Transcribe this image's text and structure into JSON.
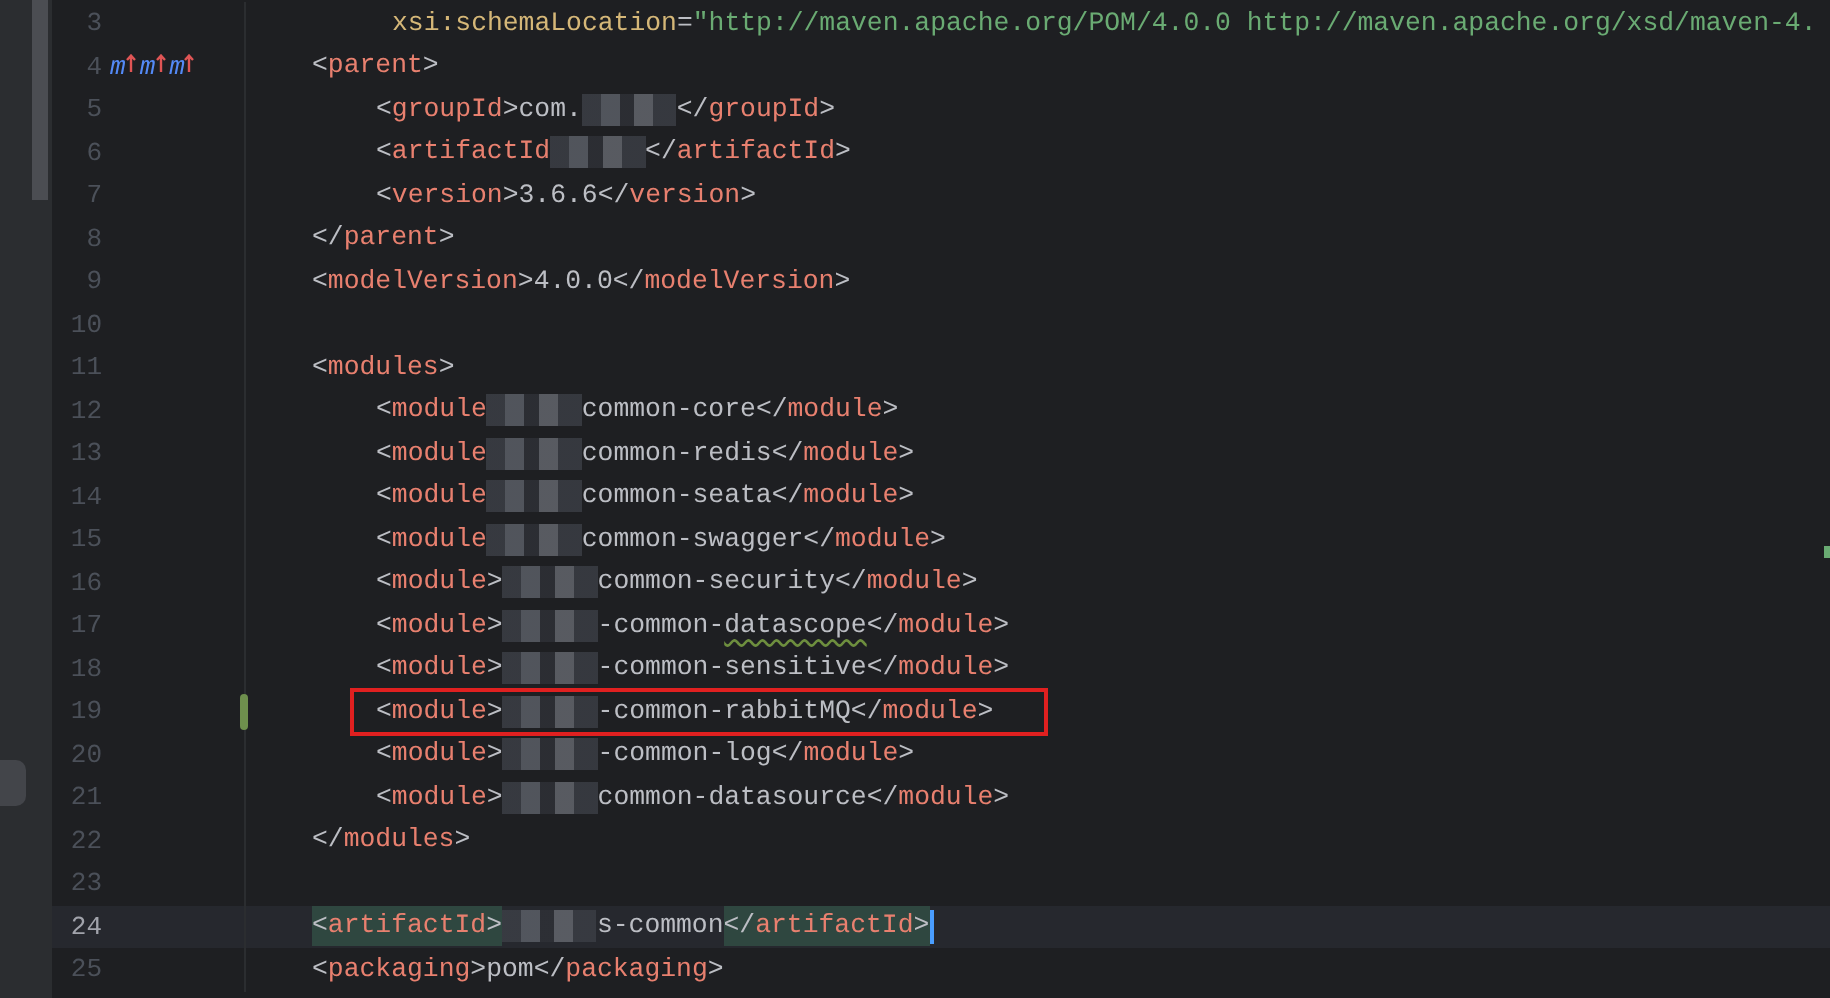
{
  "editor": {
    "lines": [
      {
        "number": "3",
        "continuation": true,
        "segments": [
          {
            "kind": "code",
            "tokens": [
              {
                "kind": "attr",
                "text": "xsi:schemaLocation"
              },
              {
                "kind": "punct",
                "text": "="
              },
              {
                "kind": "value",
                "text": "\"http://maven.apache.org/POM/4.0.0 http://maven.apache.org/xsd/maven-4."
              }
            ]
          }
        ]
      },
      {
        "number": "4",
        "gutter_marks": [
          "m",
          "m",
          "m"
        ],
        "segments": [
          {
            "kind": "code",
            "tokens": [
              {
                "kind": "punct",
                "text": "<"
              },
              {
                "kind": "tag",
                "text": "parent"
              },
              {
                "kind": "punct",
                "text": ">"
              }
            ]
          }
        ]
      },
      {
        "number": "5",
        "indented": true,
        "segments": [
          {
            "kind": "code",
            "tokens": [
              {
                "kind": "punct",
                "text": "<"
              },
              {
                "kind": "tag",
                "text": "groupId"
              },
              {
                "kind": "punct",
                "text": ">"
              },
              {
                "kind": "plain",
                "text": "com."
              }
            ]
          },
          {
            "kind": "redacted"
          },
          {
            "kind": "code",
            "tokens": [
              {
                "kind": "punct",
                "text": "</"
              },
              {
                "kind": "tag",
                "text": "groupId"
              },
              {
                "kind": "punct",
                "text": ">"
              }
            ]
          }
        ]
      },
      {
        "number": "6",
        "indented": true,
        "segments": [
          {
            "kind": "code",
            "tokens": [
              {
                "kind": "punct",
                "text": "<"
              },
              {
                "kind": "tag",
                "text": "artifactId"
              }
            ]
          },
          {
            "kind": "redacted"
          },
          {
            "kind": "code",
            "tokens": [
              {
                "kind": "punct",
                "text": "</"
              },
              {
                "kind": "tag",
                "text": "artifactId"
              },
              {
                "kind": "punct",
                "text": ">"
              }
            ]
          }
        ]
      },
      {
        "number": "7",
        "indented": true,
        "segments": [
          {
            "kind": "code",
            "tokens": [
              {
                "kind": "punct",
                "text": "<"
              },
              {
                "kind": "tag",
                "text": "version"
              },
              {
                "kind": "punct",
                "text": ">"
              },
              {
                "kind": "plain",
                "text": "3.6.6"
              },
              {
                "kind": "punct",
                "text": "</"
              },
              {
                "kind": "tag",
                "text": "version"
              },
              {
                "kind": "punct",
                "text": ">"
              }
            ]
          }
        ]
      },
      {
        "number": "8",
        "segments": [
          {
            "kind": "code",
            "tokens": [
              {
                "kind": "punct",
                "text": "</"
              },
              {
                "kind": "tag",
                "text": "parent"
              },
              {
                "kind": "punct",
                "text": ">"
              }
            ]
          }
        ]
      },
      {
        "number": "9",
        "segments": [
          {
            "kind": "code",
            "tokens": [
              {
                "kind": "punct",
                "text": "<"
              },
              {
                "kind": "tag",
                "text": "modelVersion"
              },
              {
                "kind": "punct",
                "text": ">"
              },
              {
                "kind": "plain",
                "text": "4.0.0"
              },
              {
                "kind": "punct",
                "text": "</"
              },
              {
                "kind": "tag",
                "text": "modelVersion"
              },
              {
                "kind": "punct",
                "text": ">"
              }
            ]
          }
        ]
      },
      {
        "number": "10"
      },
      {
        "number": "11",
        "segments": [
          {
            "kind": "code",
            "tokens": [
              {
                "kind": "punct",
                "text": "<"
              },
              {
                "kind": "tag",
                "text": "modules"
              },
              {
                "kind": "punct",
                "text": ">"
              }
            ]
          }
        ]
      },
      {
        "number": "12",
        "indented": true,
        "segments": [
          {
            "kind": "code",
            "tokens": [
              {
                "kind": "punct",
                "text": "<"
              },
              {
                "kind": "tag",
                "text": "module"
              }
            ]
          },
          {
            "kind": "redacted"
          },
          {
            "kind": "code",
            "tokens": [
              {
                "kind": "plain",
                "text": "common-core"
              },
              {
                "kind": "punct",
                "text": "</"
              },
              {
                "kind": "tag",
                "text": "module"
              },
              {
                "kind": "punct",
                "text": ">"
              }
            ]
          }
        ]
      },
      {
        "number": "13",
        "indented": true,
        "segments": [
          {
            "kind": "code",
            "tokens": [
              {
                "kind": "punct",
                "text": "<"
              },
              {
                "kind": "tag",
                "text": "module"
              }
            ]
          },
          {
            "kind": "redacted"
          },
          {
            "kind": "code",
            "tokens": [
              {
                "kind": "plain",
                "text": "common-redis"
              },
              {
                "kind": "punct",
                "text": "</"
              },
              {
                "kind": "tag",
                "text": "module"
              },
              {
                "kind": "punct",
                "text": ">"
              }
            ]
          }
        ]
      },
      {
        "number": "14",
        "indented": true,
        "segments": [
          {
            "kind": "code",
            "tokens": [
              {
                "kind": "punct",
                "text": "<"
              },
              {
                "kind": "tag",
                "text": "module"
              }
            ]
          },
          {
            "kind": "redacted"
          },
          {
            "kind": "code",
            "tokens": [
              {
                "kind": "plain",
                "text": "common-seata"
              },
              {
                "kind": "punct",
                "text": "</"
              },
              {
                "kind": "tag",
                "text": "module"
              },
              {
                "kind": "punct",
                "text": ">"
              }
            ]
          }
        ]
      },
      {
        "number": "15",
        "indented": true,
        "segments": [
          {
            "kind": "code",
            "tokens": [
              {
                "kind": "punct",
                "text": "<"
              },
              {
                "kind": "tag",
                "text": "module"
              }
            ]
          },
          {
            "kind": "redacted"
          },
          {
            "kind": "code",
            "tokens": [
              {
                "kind": "plain",
                "text": "common-swagger"
              },
              {
                "kind": "punct",
                "text": "</"
              },
              {
                "kind": "tag",
                "text": "module"
              },
              {
                "kind": "punct",
                "text": ">"
              }
            ]
          }
        ]
      },
      {
        "number": "16",
        "indented": true,
        "segments": [
          {
            "kind": "code",
            "tokens": [
              {
                "kind": "punct",
                "text": "<"
              },
              {
                "kind": "tag",
                "text": "module"
              },
              {
                "kind": "punct",
                "text": ">"
              }
            ]
          },
          {
            "kind": "redacted"
          },
          {
            "kind": "code",
            "tokens": [
              {
                "kind": "plain",
                "text": "common-security"
              },
              {
                "kind": "punct",
                "text": "</"
              },
              {
                "kind": "tag",
                "text": "module"
              },
              {
                "kind": "punct",
                "text": ">"
              }
            ]
          }
        ]
      },
      {
        "number": "17",
        "indented": true,
        "segments": [
          {
            "kind": "code",
            "tokens": [
              {
                "kind": "punct",
                "text": "<"
              },
              {
                "kind": "tag",
                "text": "module"
              },
              {
                "kind": "punct",
                "text": ">"
              }
            ]
          },
          {
            "kind": "redacted"
          },
          {
            "kind": "code",
            "tokens": [
              {
                "kind": "plain",
                "text": "-common-"
              },
              {
                "kind": "typo",
                "text": "datascope"
              },
              {
                "kind": "punct",
                "text": "</"
              },
              {
                "kind": "tag",
                "text": "module"
              },
              {
                "kind": "punct",
                "text": ">"
              }
            ]
          }
        ]
      },
      {
        "number": "18",
        "indented": true,
        "segments": [
          {
            "kind": "code",
            "tokens": [
              {
                "kind": "punct",
                "text": "<"
              },
              {
                "kind": "tag",
                "text": "module"
              },
              {
                "kind": "punct",
                "text": ">"
              }
            ]
          },
          {
            "kind": "redacted"
          },
          {
            "kind": "code",
            "tokens": [
              {
                "kind": "plain",
                "text": "-common-sensitive"
              },
              {
                "kind": "punct",
                "text": "</"
              },
              {
                "kind": "tag",
                "text": "module"
              },
              {
                "kind": "punct",
                "text": ">"
              }
            ]
          }
        ]
      },
      {
        "number": "19",
        "indented": true,
        "changed": true,
        "boxed": true,
        "segments": [
          {
            "kind": "code",
            "tokens": [
              {
                "kind": "punct",
                "text": "<"
              },
              {
                "kind": "tag",
                "text": "module"
              },
              {
                "kind": "punct",
                "text": ">"
              }
            ]
          },
          {
            "kind": "redacted"
          },
          {
            "kind": "code",
            "tokens": [
              {
                "kind": "plain",
                "text": "-common-rabbitMQ"
              },
              {
                "kind": "punct",
                "text": "</"
              },
              {
                "kind": "tag",
                "text": "module"
              },
              {
                "kind": "punct",
                "text": ">"
              }
            ]
          }
        ]
      },
      {
        "number": "20",
        "indented": true,
        "segments": [
          {
            "kind": "code",
            "tokens": [
              {
                "kind": "punct",
                "text": "<"
              },
              {
                "kind": "tag",
                "text": "module"
              },
              {
                "kind": "punct",
                "text": ">"
              }
            ]
          },
          {
            "kind": "redacted"
          },
          {
            "kind": "code",
            "tokens": [
              {
                "kind": "plain",
                "text": "-common-log"
              },
              {
                "kind": "punct",
                "text": "</"
              },
              {
                "kind": "tag",
                "text": "module"
              },
              {
                "kind": "punct",
                "text": ">"
              }
            ]
          }
        ]
      },
      {
        "number": "21",
        "indented": true,
        "segments": [
          {
            "kind": "code",
            "tokens": [
              {
                "kind": "punct",
                "text": "<"
              },
              {
                "kind": "tag",
                "text": "module"
              },
              {
                "kind": "punct",
                "text": ">"
              }
            ]
          },
          {
            "kind": "redacted"
          },
          {
            "kind": "code",
            "tokens": [
              {
                "kind": "plain",
                "text": "common-datasource"
              },
              {
                "kind": "punct",
                "text": "</"
              },
              {
                "kind": "tag",
                "text": "module"
              },
              {
                "kind": "punct",
                "text": ">"
              }
            ]
          }
        ]
      },
      {
        "number": "22",
        "segments": [
          {
            "kind": "code",
            "tokens": [
              {
                "kind": "punct",
                "text": "</"
              },
              {
                "kind": "tag",
                "text": "modules"
              },
              {
                "kind": "punct",
                "text": ">"
              }
            ]
          }
        ]
      },
      {
        "number": "23"
      },
      {
        "number": "24",
        "current": true,
        "caret": true,
        "segments": [
          {
            "kind": "match",
            "tokens": [
              {
                "kind": "punct",
                "text": "<"
              },
              {
                "kind": "tag",
                "text": "artifactId"
              },
              {
                "kind": "punct",
                "text": ">"
              }
            ]
          },
          {
            "kind": "redacted"
          },
          {
            "kind": "code",
            "tokens": [
              {
                "kind": "plain",
                "text": "s-common"
              }
            ]
          },
          {
            "kind": "match",
            "tokens": [
              {
                "kind": "punct",
                "text": "</"
              },
              {
                "kind": "tag",
                "text": "artifactId"
              },
              {
                "kind": "punct",
                "text": ">"
              }
            ]
          }
        ]
      },
      {
        "number": "25",
        "segments": [
          {
            "kind": "code",
            "tokens": [
              {
                "kind": "punct",
                "text": "<"
              },
              {
                "kind": "tag",
                "text": "packaging"
              },
              {
                "kind": "punct",
                "text": ">"
              },
              {
                "kind": "plain",
                "text": "pom"
              },
              {
                "kind": "punct",
                "text": "</"
              },
              {
                "kind": "tag",
                "text": "packaging"
              },
              {
                "kind": "punct",
                "text": ">"
              }
            ]
          }
        ]
      }
    ]
  }
}
